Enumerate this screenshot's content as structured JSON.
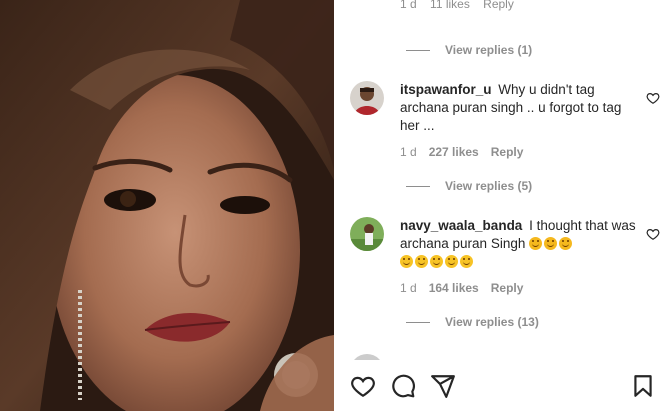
{
  "post": {
    "media_description": "close-up portrait image"
  },
  "comments_panel": {
    "cut_off_meta": {
      "time": "1 d",
      "likes": "11 likes",
      "reply": "Reply"
    },
    "view_replies_1": "View replies (1)",
    "comments": [
      {
        "username": "itspawanfor_u",
        "text": "Why u didn't tag archana puran singh .. u forgot to tag her ...",
        "time": "1 d",
        "likes": "227 likes",
        "reply_label": "Reply",
        "view_replies": "View replies (5)"
      },
      {
        "username": "navy_waala_banda",
        "text": "I thought that was archana puran Singh",
        "time": "1 d",
        "likes": "164 likes",
        "reply_label": "Reply",
        "view_replies": "View replies (13)"
      }
    ]
  },
  "actions": {
    "like": "heart-icon",
    "comment": "comment-icon",
    "share": "share-icon",
    "save": "bookmark-icon"
  },
  "colors": {
    "text": "#262626",
    "secondary": "#8e8e8e",
    "background": "#ffffff"
  }
}
